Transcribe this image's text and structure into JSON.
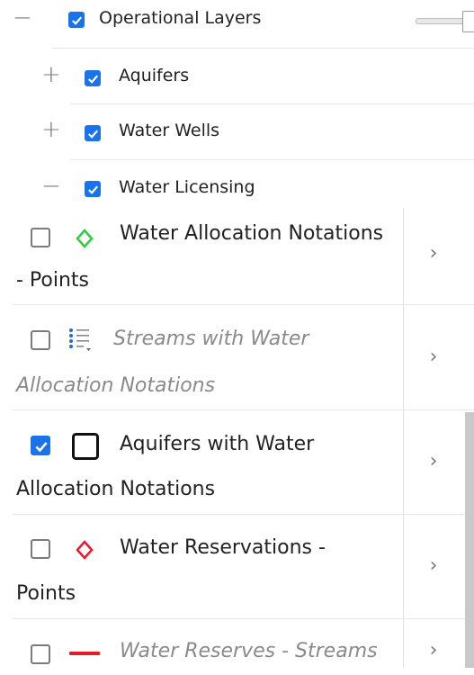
{
  "header": {
    "collapse_symbol": "−",
    "label": "Operational Layers"
  },
  "tree": [
    {
      "symbol": "+",
      "label": "Aquifers"
    },
    {
      "symbol": "+",
      "label": "Water Wells"
    },
    {
      "symbol": "−",
      "label": "Water Licensing"
    }
  ],
  "items": [
    {
      "line1": "Water Allocation Notations",
      "line2": "- Points",
      "checked": false,
      "icon": "green-diamond-icon",
      "chevron": "›"
    },
    {
      "line1": "Streams with Water",
      "line2": "Allocation Notations",
      "checked": false,
      "icon": "legend-list-icon",
      "chevron": "›"
    },
    {
      "line1": "Aquifers with Water",
      "line2": "Allocation Notations",
      "checked": true,
      "icon": "black-square-icon",
      "chevron": "›"
    },
    {
      "line1": "Water Reservations -",
      "line2": "Points",
      "checked": false,
      "icon": "red-diamond-icon",
      "chevron": "›"
    },
    {
      "line1": "Water Reserves - Streams",
      "checked": false,
      "icon": "red-line-icon",
      "chevron": "›"
    }
  ],
  "colors": {
    "checkbox_checked": "#1a73e8",
    "green_diamond": "#2ecc40",
    "red_diamond": "#e8192c",
    "red_line": "#e8192c"
  }
}
